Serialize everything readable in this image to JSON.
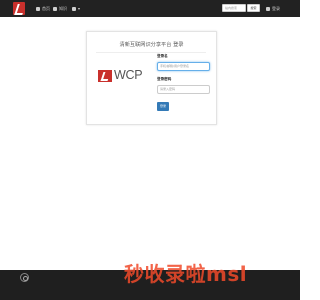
{
  "nav": {
    "home": "首页",
    "knowledge": "知识",
    "more": "▾"
  },
  "search": {
    "placeholder": "站内搜索",
    "button": "搜索"
  },
  "user": {
    "login": "登录"
  },
  "panel": {
    "title": "清新互联网识分享平台 登录",
    "logo_text": "WCP",
    "username_label": "登录名",
    "username_placeholder": "手机/邮箱/用户登录名",
    "password_label": "登录密码",
    "password_placeholder": "请录入密码",
    "login_button": "登录"
  },
  "watermark": "秒收录啦msl",
  "colors": {
    "brand": "#c9302c",
    "nav_bg": "#222222",
    "primary": "#337ab7",
    "watermark": "#f04a2a"
  }
}
